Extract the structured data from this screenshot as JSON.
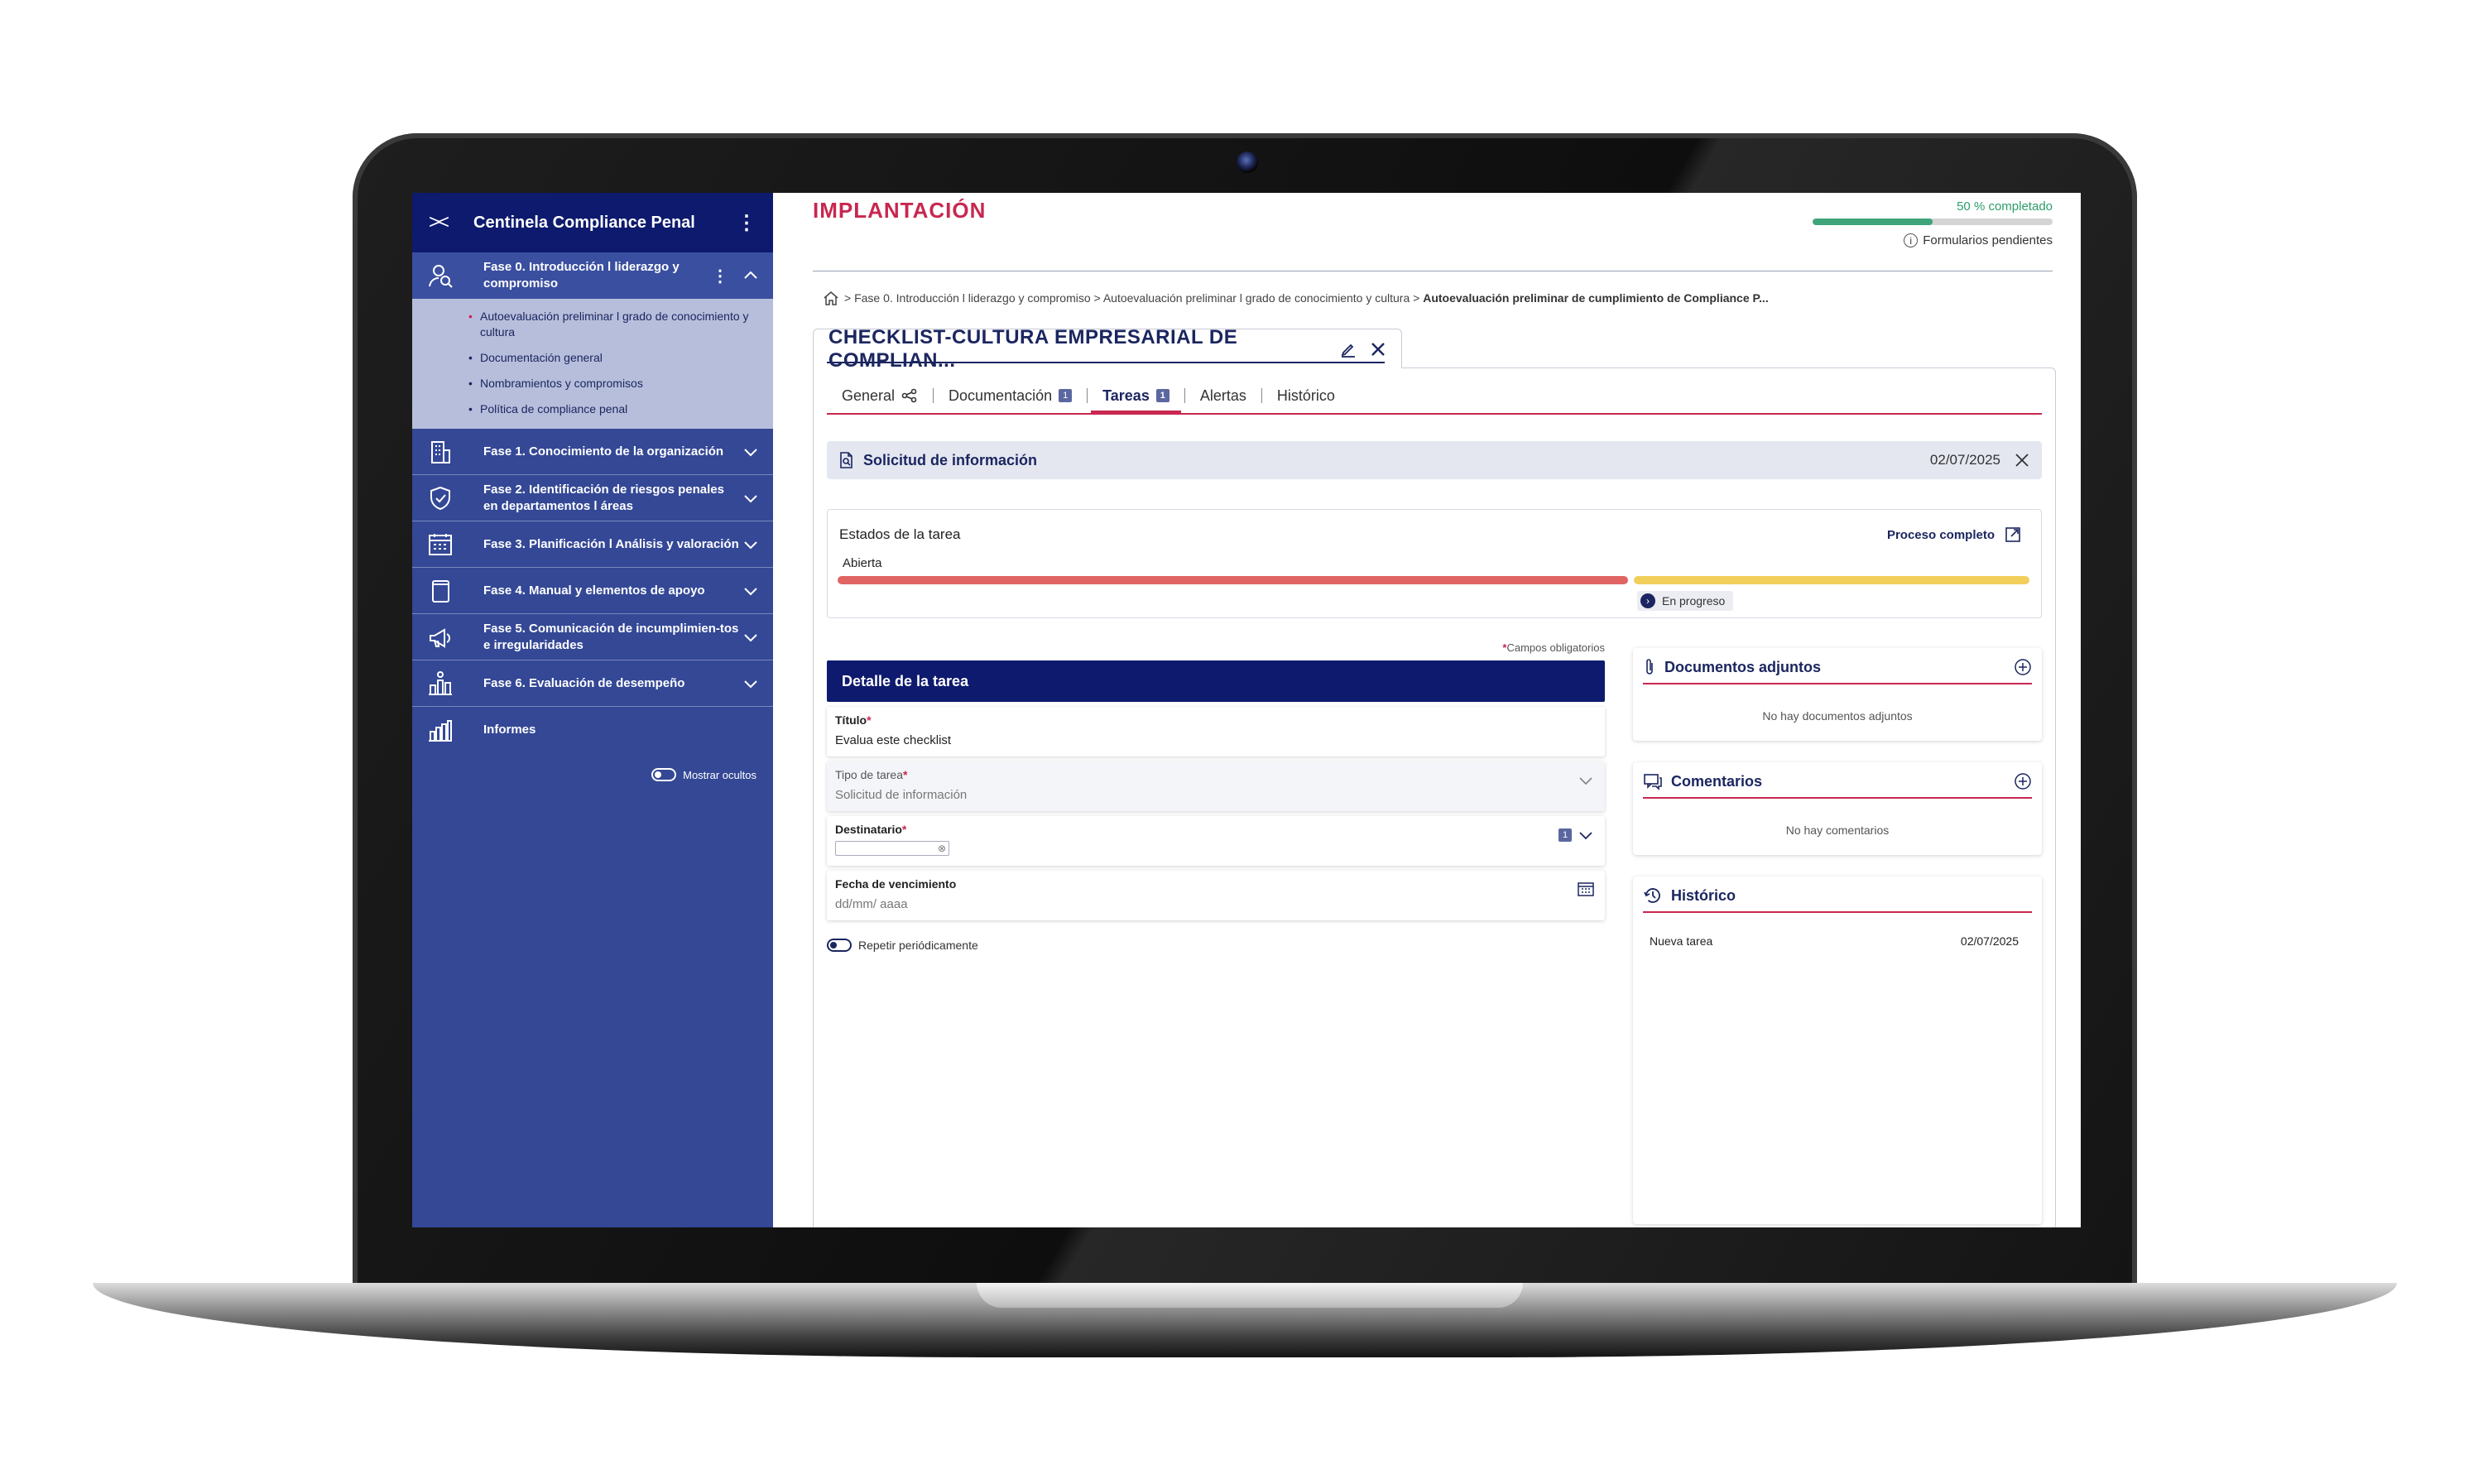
{
  "sidebar": {
    "title": "Centinela Compliance Penal",
    "phases": [
      {
        "label": "Fase 0. Introducción  l  liderazgo y compromiso",
        "icon": "user-search-icon",
        "expanded": true
      },
      {
        "label": "Fase 1. Conocimiento de la organización",
        "icon": "building-icon"
      },
      {
        "label": "Fase 2. Identificación de riesgos penales en departamentos  l  áreas",
        "icon": "shield-check-icon"
      },
      {
        "label": "Fase 3. Planificación  l  Análisis y valoración",
        "icon": "calendar-icon"
      },
      {
        "label": "Fase 4. Manual y elementos de apoyo",
        "icon": "book-icon"
      },
      {
        "label": "Fase 5. Comunicación de incumplimien-tos e irregularidades",
        "icon": "megaphone-icon"
      },
      {
        "label": "Fase 6. Evaluación de desempeño",
        "icon": "chart-people-icon"
      },
      {
        "label": "Informes",
        "icon": "bar-chart-icon"
      }
    ],
    "subitems": [
      {
        "label": "Autoevaluación preliminar  l  grado de conocimiento y cultura",
        "current": true
      },
      {
        "label": "Documentación general"
      },
      {
        "label": "Nombramientos y compromisos"
      },
      {
        "label": "Política de compliance penal"
      }
    ],
    "show_hidden": "Mostrar ocultos"
  },
  "header": {
    "section": "IMPLANTACIÓN",
    "progress_label": "50 % completado",
    "progress_value": 0.5,
    "pending_forms": "Formularios pendientes"
  },
  "breadcrumb": {
    "path": "> Fase 0. Introducción  l  liderazgo y compromiso > Autoevaluación preliminar  l  grado de conocimiento y cultura >",
    "current": "Autoevaluación preliminar de cumplimiento de Compliance P..."
  },
  "document": {
    "title": "CHECKLIST-CULTURA EMPRESARIAL DE COMPLIAN..."
  },
  "tabs": [
    {
      "label": "General"
    },
    {
      "label": "Documentación",
      "badge": "1"
    },
    {
      "label": "Tareas",
      "badge": "1",
      "active": true
    },
    {
      "label": "Alertas"
    },
    {
      "label": "Histórico"
    }
  ],
  "request": {
    "title": "Solicitud de información",
    "date": "02/07/2025"
  },
  "task_states": {
    "title": "Estados de la tarea",
    "link": "Proceso completo",
    "open": "Abierta",
    "in_progress": "En progreso"
  },
  "form": {
    "required_note": "Campos obligatorios",
    "header": "Detalle de la tarea",
    "title_label": "Título",
    "title_value": "Evalua este checklist",
    "type_label": "Tipo de tarea",
    "type_value": "Solicitud de información",
    "recipient_label": "Destinatario",
    "recipient_badge": "1",
    "due_label": "Fecha de vencimiento",
    "due_placeholder": "dd/mm/ aaaa",
    "repeat_label": "Repetir periódicamente"
  },
  "attachments": {
    "title": "Documentos adjuntos",
    "empty": "No hay documentos adjuntos"
  },
  "comments": {
    "title": "Comentarios",
    "empty": "No hay comentarios"
  },
  "history": {
    "title": "Histórico",
    "entries": [
      {
        "event": "Nueva tarea",
        "date": "02/07/2025"
      }
    ]
  },
  "colors": {
    "navy": "#0d1a6e",
    "sidebar": "#344896",
    "accent": "#c8274f",
    "progress": "#3fa47a",
    "state_open": "#e06464",
    "state_progress": "#f2cf5b"
  }
}
